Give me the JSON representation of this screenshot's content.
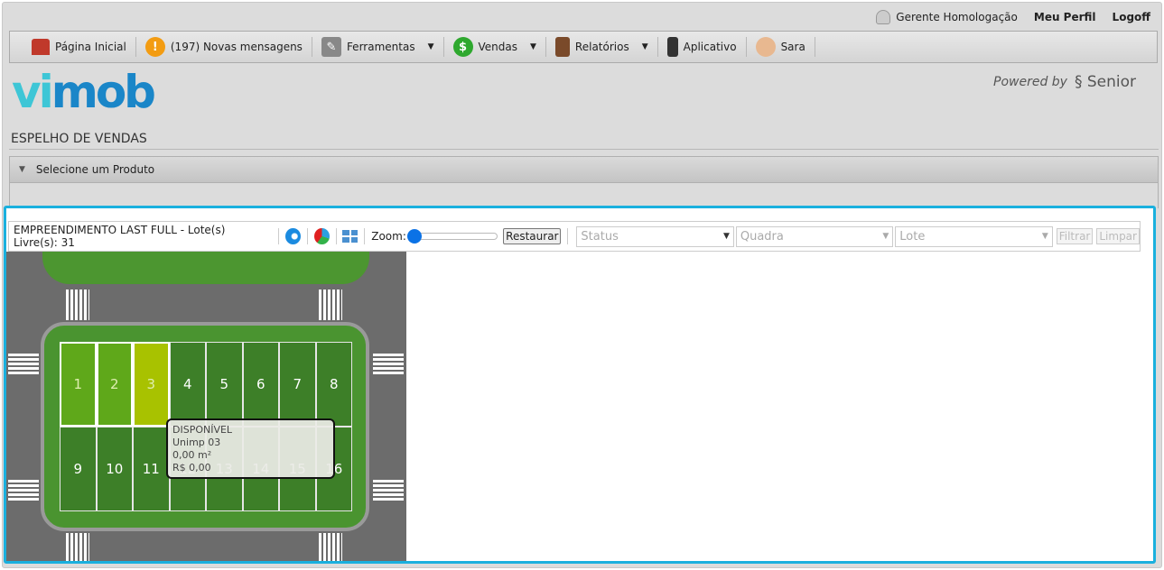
{
  "topbar": {
    "user": "Gerente Homologação",
    "profile": "Meu Perfil",
    "logoff": "Logoff"
  },
  "nav": [
    {
      "label": "Página Inicial",
      "icon": "home-icon"
    },
    {
      "label": "(197) Novas mensagens",
      "icon": "alert-icon"
    },
    {
      "label": "Ferramentas",
      "icon": "tools-icon",
      "dropdown": true
    },
    {
      "label": "Vendas",
      "icon": "dollar-icon",
      "dropdown": true
    },
    {
      "label": "Relatórios",
      "icon": "report-icon",
      "dropdown": true
    },
    {
      "label": "Aplicativo",
      "icon": "phone-icon"
    },
    {
      "label": "Sara",
      "icon": "avatar-icon"
    }
  ],
  "logo": {
    "a": "vi",
    "b": "mob"
  },
  "powered": {
    "text": "Powered by",
    "brand": "Senior"
  },
  "page_title": "ESPELHO DE VENDAS",
  "accordion": {
    "label": "Selecione um Produto"
  },
  "toolbar": {
    "info": "EMPREENDIMENTO LAST FULL - Lote(s) Livre(s): 31",
    "zoom_label": "Zoom:",
    "zoom_value": 0,
    "restore": "Restaurar",
    "status_placeholder": "Status",
    "quadra_placeholder": "Quadra",
    "lote_placeholder": "Lote",
    "filter": "Filtrar",
    "clear": "Limpar"
  },
  "lots": [
    {
      "n": "1",
      "color": "#5fa81a"
    },
    {
      "n": "2",
      "color": "#5fa81a"
    },
    {
      "n": "3",
      "color": "#a8c200"
    },
    {
      "n": "4"
    },
    {
      "n": "5"
    },
    {
      "n": "6"
    },
    {
      "n": "7"
    },
    {
      "n": "8"
    },
    {
      "n": "9"
    },
    {
      "n": "10"
    },
    {
      "n": "11"
    },
    {
      "n": "12"
    },
    {
      "n": "13"
    },
    {
      "n": "14"
    },
    {
      "n": "15"
    },
    {
      "n": "16"
    }
  ],
  "tooltip": {
    "status": "DISPONÍVEL",
    "name": "Unimp 03",
    "area": "0,00 m²",
    "price": "R$ 0,00"
  },
  "colors": {
    "accent": "#1ab0de",
    "lot": "#3d7f28",
    "selected": "#5fa81a",
    "hover": "#a8c200"
  }
}
